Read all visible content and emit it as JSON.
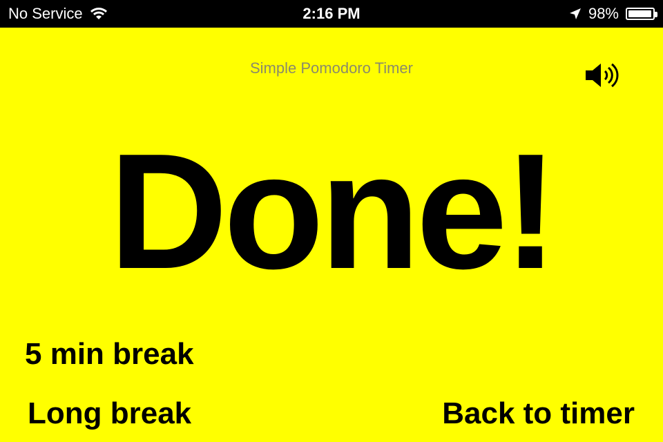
{
  "status_bar": {
    "carrier": "No Service",
    "time": "2:16 PM",
    "battery_percent": "98%",
    "battery_level": 0.98,
    "icons": [
      "wifi-icon",
      "location-arrow-icon",
      "battery-icon"
    ]
  },
  "app": {
    "title": "Simple Pomodoro Timer",
    "sound_icon": "speaker-icon",
    "headline": "Done!",
    "background_color": "#ffff00"
  },
  "actions": {
    "short_break": "5 min break",
    "long_break": "Long break",
    "back_to_timer": "Back to timer"
  }
}
